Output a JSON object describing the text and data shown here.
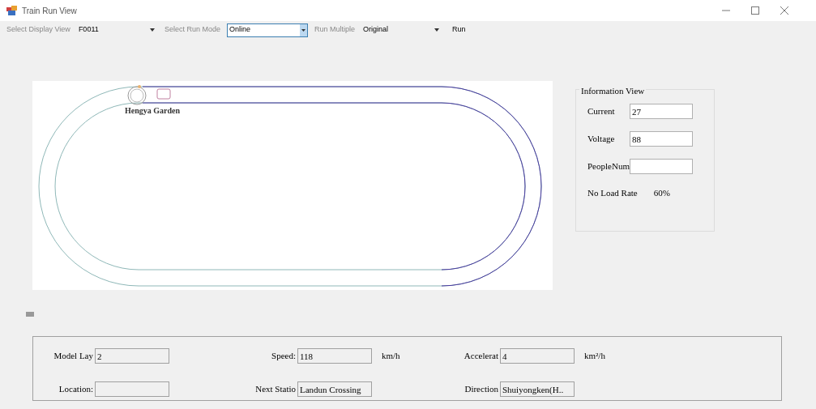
{
  "window": {
    "title": "Train Run View"
  },
  "toolbar": [
    {
      "label": "Select Display View",
      "value": "F0011",
      "focused": false
    },
    {
      "label": "Select Run Mode",
      "value": "Online",
      "focused": true
    },
    {
      "label": "Run Multiple",
      "value": "Original",
      "focused": false
    }
  ],
  "run_button": "Run",
  "track": {
    "station": "Hengya Garden"
  },
  "information_view": {
    "title": "Information View",
    "fields": [
      {
        "label": "Current",
        "value": "27"
      },
      {
        "label": "Voltage",
        "value": "88"
      },
      {
        "label": "PeopleNum"
      }
    ],
    "no_load_rate": {
      "label": "No Load Rate",
      "value": "60%"
    }
  },
  "details": [
    {
      "label": "Model Lay",
      "value": "2"
    },
    {
      "label": "Speed:",
      "value": "118",
      "unit": "km/h"
    },
    {
      "label": "Accelerat",
      "value": "4",
      "unit": "km²/h"
    },
    {
      "label": "Location:"
    },
    {
      "label": "Next Statio",
      "value": "Landun Crossing"
    },
    {
      "label": "Direction",
      "value": "Shuiyongken(H.."
    }
  ]
}
